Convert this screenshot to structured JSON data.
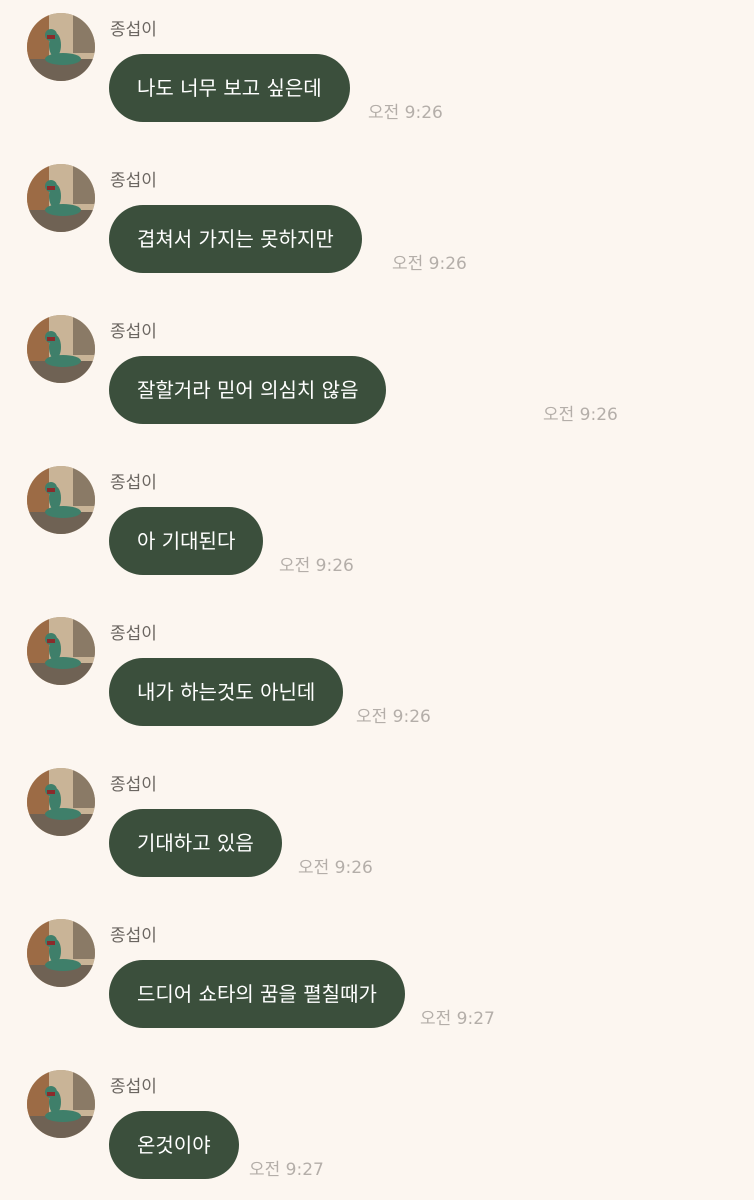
{
  "messages": [
    {
      "sender": "종섭이",
      "text": "나도 너무 보고 싶은데",
      "time": "오전 9:26"
    },
    {
      "sender": "종섭이",
      "text": "겹쳐서 가지는 못하지만",
      "time": "오전 9:26"
    },
    {
      "sender": "종섭이",
      "text": "잘할거라 믿어 의심치 않음",
      "time": "오전 9:26"
    },
    {
      "sender": "종섭이",
      "text": "아 기대된다",
      "time": "오전 9:26"
    },
    {
      "sender": "종섭이",
      "text": "내가 하는것도 아닌데",
      "time": "오전 9:26"
    },
    {
      "sender": "종섭이",
      "text": "기대하고 있음",
      "time": "오전 9:26"
    },
    {
      "sender": "종섭이",
      "text": "드디어 쇼타의 꿈을 펼칠때가",
      "time": "오전 9:27"
    },
    {
      "sender": "종섭이",
      "text": "온것이야",
      "time": "오전 9:27"
    }
  ],
  "icons": {
    "avatar": "lizard-profile-photo-icon"
  },
  "colors": {
    "background": "#fcf6f0",
    "bubble": "#3b4f3c",
    "bubble_text": "#ffffff",
    "sender_text": "#6b6661",
    "time_text": "#b4aea9"
  }
}
